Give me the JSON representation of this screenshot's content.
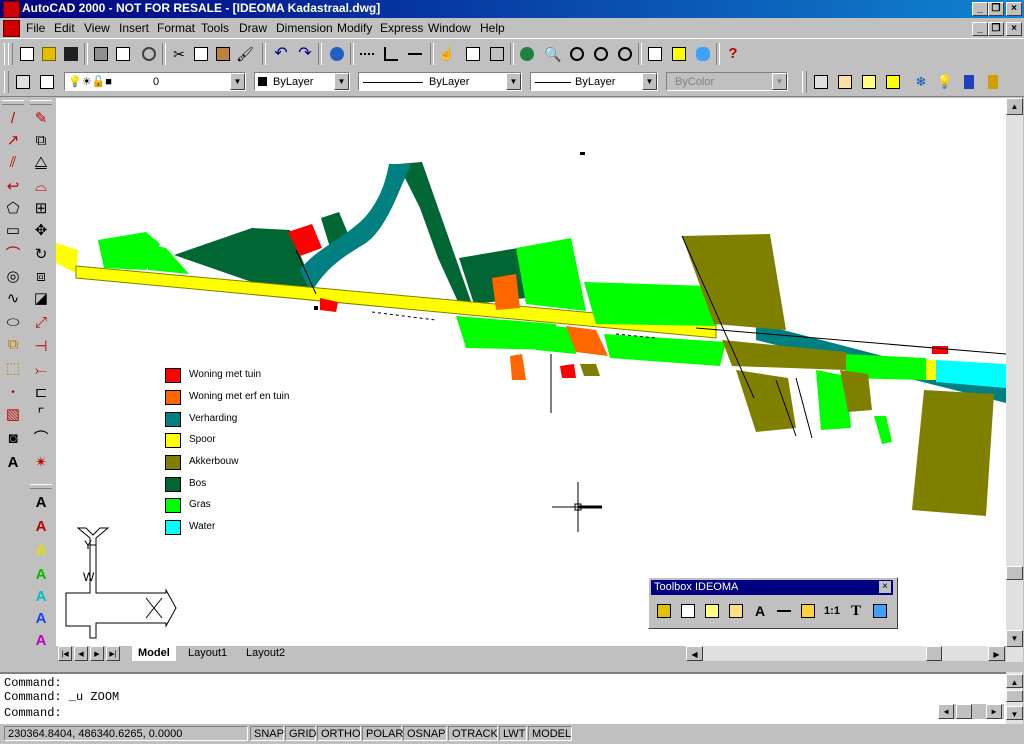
{
  "window": {
    "title": "AutoCAD 2000 - NOT FOR RESALE - [IDEOMA Kadastraal.dwg]"
  },
  "menu": [
    "File",
    "Edit",
    "View",
    "Insert",
    "Format",
    "Tools",
    "Draw",
    "Dimension",
    "Modify",
    "Express",
    "Window",
    "Help"
  ],
  "properties": {
    "layer_value": "0",
    "color_value": "ByLayer",
    "linetype_value": "ByLayer",
    "lineweight_value": "ByLayer",
    "plotstyle_value": "ByColor"
  },
  "legend": [
    {
      "label": "Woning met tuin",
      "color": "#ff0000"
    },
    {
      "label": "Woning met erf en tuin",
      "color": "#ff6600"
    },
    {
      "label": "Verharding",
      "color": "#008080"
    },
    {
      "label": "Spoor",
      "color": "#ffff00"
    },
    {
      "label": "Akkerbouw",
      "color": "#808000"
    },
    {
      "label": "Bos",
      "color": "#006633"
    },
    {
      "label": "Gras",
      "color": "#00ff00"
    },
    {
      "label": "Water",
      "color": "#00ffff"
    }
  ],
  "ucs": {
    "y_label": "Y",
    "w_label": "W"
  },
  "layout_tabs": [
    "Model",
    "Layout1",
    "Layout2"
  ],
  "floating_toolbar": {
    "title": "Toolbox IDEOMA"
  },
  "command_lines": [
    "Command:",
    "Command: _u ZOOM",
    "Command:"
  ],
  "status": {
    "coordinates": "230364.8404, 486340.6265, 0.0000",
    "toggles": [
      "SNAP",
      "GRID",
      "ORTHO",
      "POLAR",
      "OSNAP",
      "OTRACK",
      "LWT",
      "MODEL"
    ]
  },
  "icons": {
    "standard_toolbar": [
      "new-icon",
      "open-icon",
      "save-icon",
      "print-icon",
      "print-preview-icon",
      "spelling-icon",
      "cut-icon",
      "copy-icon",
      "paste-icon",
      "match-properties-icon",
      "undo-icon",
      "redo-icon",
      "hyperlink-icon",
      "tracking-icon",
      "ucs-icon",
      "distance-icon",
      "properties-icon",
      "design-center-icon",
      "pan-icon",
      "zoom-realtime-icon",
      "zoom-window-icon",
      "zoom-previous-icon",
      "aerial-view-icon",
      "named-views-icon",
      "database-icon",
      "help-icon"
    ],
    "colors": {
      "titlebar": "#000080",
      "drawing_bg": "#ffffff",
      "chrome": "#c0c0c0"
    }
  }
}
